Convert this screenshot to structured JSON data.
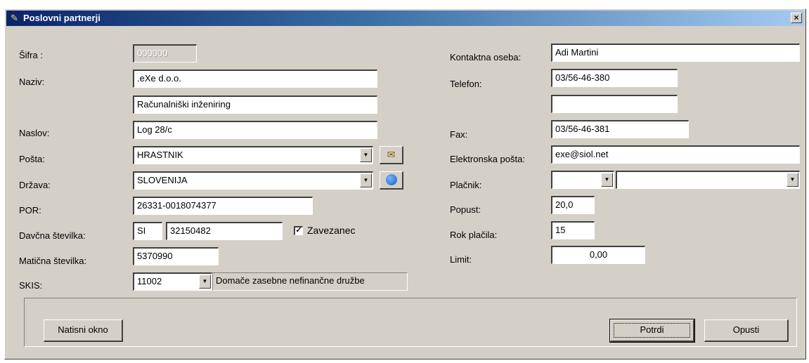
{
  "window": {
    "title": "Poslovni partnerji",
    "close_label": "×"
  },
  "left": {
    "sifra": {
      "label": "Šifra :",
      "value": "000000"
    },
    "naziv": {
      "label": "Naziv:",
      "value1": ".eXe d.o.o.",
      "value2": "Računalniški inženiring"
    },
    "naslov": {
      "label": "Naslov:",
      "value": "Log 28/c"
    },
    "posta": {
      "label": "Pošta:",
      "value": "HRASTNIK",
      "button_icon": "envelope-icon"
    },
    "drzava": {
      "label": "Država:",
      "value": "SLOVENIJA",
      "button_icon": "globe-icon"
    },
    "por": {
      "label": "POR:",
      "value": "26331-0018074377"
    },
    "davcna": {
      "label": "Davčna številka:",
      "prefix": "SI",
      "value": "32150482",
      "checkbox_label": "Zavezanec",
      "checked": true
    },
    "maticna": {
      "label": "Matična številka:",
      "value": "5370990"
    },
    "skis": {
      "label": "SKIS:",
      "value": "11002",
      "description": "Domače zasebne nefinančne družbe"
    }
  },
  "right": {
    "kontakt": {
      "label": "Kontaktna oseba:",
      "value": "Adi Martini"
    },
    "telefon": {
      "label": "Telefon:",
      "value1": "03/56-46-380",
      "value2": ""
    },
    "fax": {
      "label": "Fax:",
      "value": "03/56-46-381"
    },
    "email": {
      "label": "Elektronska pošta:",
      "value": "exe@siol.net"
    },
    "placnik": {
      "label": "Plačnik:",
      "value1": "",
      "value2": ""
    },
    "popust": {
      "label": "Popust:",
      "value": "20,0"
    },
    "rok": {
      "label": "Rok plačila:",
      "value": "15"
    },
    "limit": {
      "label": "Limit:",
      "value": "0,00"
    }
  },
  "buttons": {
    "print": "Natisni okno",
    "confirm": "Potrdi",
    "cancel": "Opusti"
  },
  "colors": {
    "titlebar_start": "#0a246a",
    "titlebar_end": "#a6caf0",
    "face": "#d4d0c8"
  }
}
